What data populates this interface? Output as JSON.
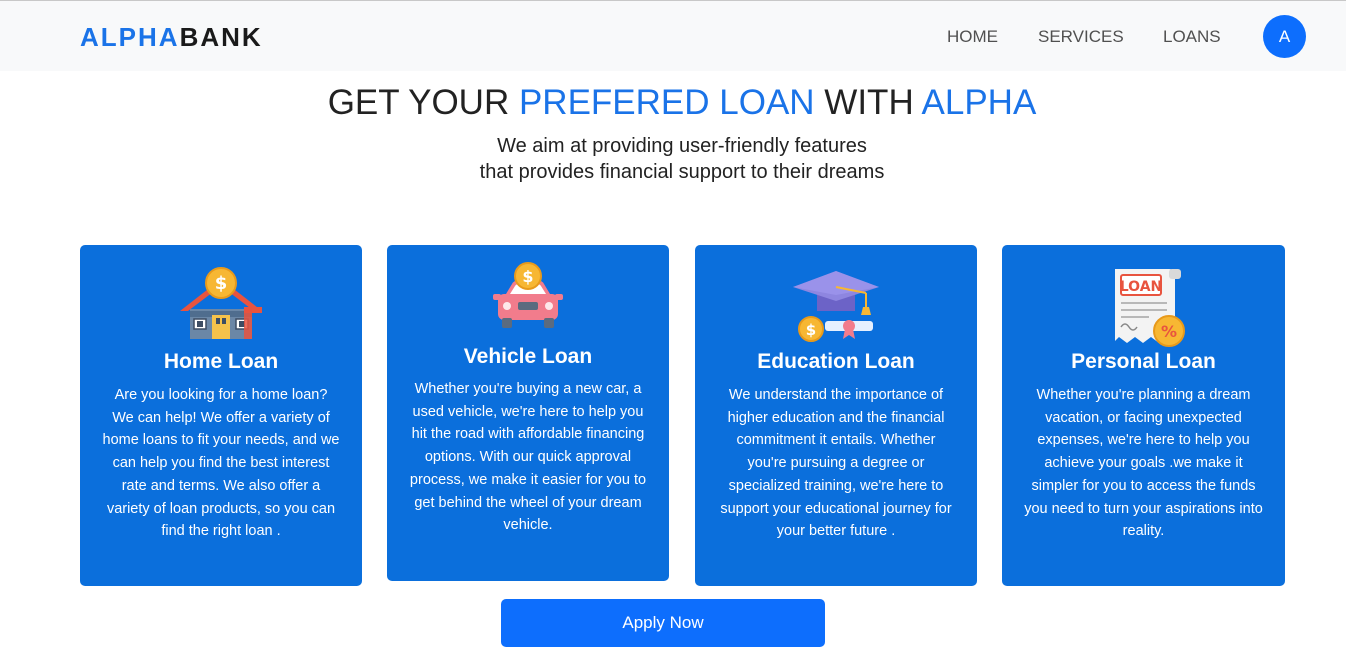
{
  "nav": {
    "brand_part1": "ALPHA",
    "brand_part2": "BANK",
    "links": [
      "HOME",
      "SERVICES",
      "LOANS"
    ],
    "avatar_initial": "A"
  },
  "hero": {
    "title_1": "GET YOUR ",
    "title_2": "PREFERED LOAN",
    "title_3": " WITH ",
    "title_4": "ALPHA",
    "subtitle_line1": "We aim at providing user-friendly features",
    "subtitle_line2": "that provides financial support to their dreams"
  },
  "cards": [
    {
      "icon": "house-dollar-icon",
      "title": "Home Loan",
      "description": "Are you looking for a home loan? We can help! We offer a variety of home loans to fit your needs, and we can help you find the best interest rate and terms. We also offer a variety of loan products, so you can find the right loan ."
    },
    {
      "icon": "car-dollar-icon",
      "title": "Vehicle Loan",
      "description": "Whether you're buying a new car, a used vehicle, we're here to help you hit the road with affordable financing options. With our quick approval process, we make it easier for you to get behind the wheel of your dream vehicle."
    },
    {
      "icon": "graduation-cap-icon",
      "title": "Education Loan",
      "description": "We understand the importance of higher education and the financial commitment it entails. Whether you're pursuing a degree or specialized training, we're here to support your educational journey for your better future ."
    },
    {
      "icon": "loan-document-icon",
      "title": "Personal Loan",
      "description": "Whether you're planning a dream vacation, or facing unexpected expenses, we're here to help you achieve your goals .we make it simpler for you to access the funds you need to turn your aspirations into reality."
    }
  ],
  "apply_button": "Apply Now",
  "colors": {
    "accent": "#1a73e8",
    "card_bg": "#0b6fdc",
    "button_bg": "#0d6efd"
  }
}
